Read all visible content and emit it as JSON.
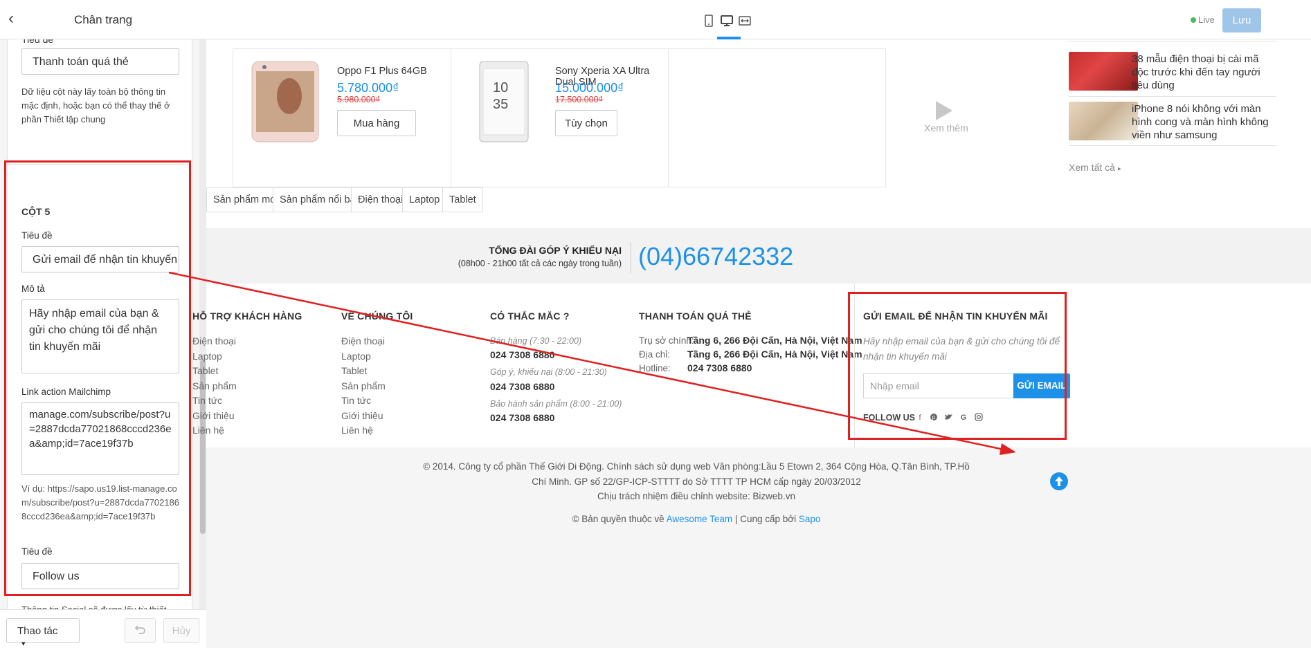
{
  "panel": {
    "title": "Chân trang",
    "back_icon": "chevron-left-icon",
    "col4": {
      "title_label": "Tiêu đề",
      "title_value": "Thanh toán quá thẻ",
      "hint": "Dữ liệu cột này lấy toàn bộ thông tin mặc định, hoặc bạn có thể thay thế ở phần Thiết lập chung"
    },
    "col5": {
      "heading": "CỘT 5",
      "title_label": "Tiêu đề",
      "title_value": "Gửi email để nhận tin khuyến mãi",
      "desc_label": "Mô tả",
      "desc_value": "Hãy nhập email của bạn & gửi cho chúng tôi để nhận tin khuyến mãi",
      "mailchimp_label": "Link action Mailchimp",
      "mailchimp_value": "manage.com/subscribe/post?u=2887dcda77021868cccd236ea&amp;id=7ace19f37b",
      "mailchimp_hint": "Ví dụ: https://sapo.us19.list-manage.com/subscribe/post?u=2887dcda77021868cccd236ea&amp;id=7ace19f37b",
      "follow_label": "Tiêu đề",
      "follow_value": "Follow us",
      "social_hint": "Thông tin Social sẽ được lấy từ thiết lập Social media"
    },
    "footer": {
      "actions_label": "Thao tác",
      "actions_caret": "▾",
      "undo_icon": "undo-icon",
      "cancel_label": "Hủy"
    }
  },
  "topbar": {
    "devices": [
      "mobile-icon",
      "desktop-icon",
      "fullwidth-icon"
    ],
    "active_device": "desktop-icon",
    "live_label": "Live",
    "save_label": "Lưu"
  },
  "preview": {
    "products": [
      {
        "name": "Oppo F1 Plus 64GB",
        "price": "5.780.000₫",
        "old_price": "5.980.000₫",
        "button": "Mua hàng"
      },
      {
        "name": "Sony Xperia XA Ultra Dual SIM",
        "price": "15.000.000₫",
        "old_price": "17.500.000₫",
        "button": "Tùy chọn"
      }
    ],
    "see_more": "Xem thêm",
    "news": [
      {
        "title": "38 mẫu điện thoại bị cài mã độc trước khi đến tay người tiêu dùng"
      },
      {
        "title": "iPhone 8 nói không với màn hình cong và màn hình không viền như samsung"
      }
    ],
    "see_all": "Xem tất cả",
    "tabs": [
      "Sản phẩm mới",
      "Sản phẩm nổi bật",
      "Điện thoại",
      "Laptop",
      "Tablet"
    ],
    "hotline": {
      "title": "TỔNG ĐÀI GÓP Ý KHIẾU NẠI",
      "hours": "(08h00 - 21h00 tất cả các ngày trong tuần)",
      "number": "(04)66742332"
    },
    "footer_cols": [
      {
        "title": "HỖ TRỢ KHÁCH HÀNG",
        "links": [
          "Điện thoại",
          "Laptop",
          "Tablet",
          "Sản phẩm",
          "Tin tức",
          "Giới thiệu",
          "Liên hệ"
        ]
      },
      {
        "title": "VỀ CHÚNG TÔI",
        "links": [
          "Điện thoại",
          "Laptop",
          "Tablet",
          "Sản phẩm",
          "Tin tức",
          "Giới thiệu",
          "Liên hệ"
        ]
      }
    ],
    "faq": {
      "title": "CÓ THẮC MẮC ?",
      "items": [
        {
          "label": "Bán hàng (7:30 - 22:00)",
          "phone": "024 7308 6880"
        },
        {
          "label": "Góp ý, khiếu nại (8:00 - 21:30)",
          "phone": "024 7308 6880"
        },
        {
          "label": "Bảo hành sản phẩm (8:00 - 21:00)",
          "phone": "024 7308 6880"
        }
      ]
    },
    "payment": {
      "title": "THANH TOÁN QUÁ THẺ",
      "rows": [
        {
          "label": "Trụ sở chính:",
          "value": "Tầng 6, 266 Đội Cấn, Hà Nội, Việt Nam"
        },
        {
          "label": "Địa chỉ:",
          "value": "Tầng 6, 266 Đội Cấn, Hà Nội, Việt Nam"
        },
        {
          "label": "Hotline:",
          "value": "024 7308 6880"
        }
      ]
    },
    "newsletter": {
      "title": "GỬI EMAIL ĐỂ NHẬN TIN KHUYẾN MÃI",
      "desc": "Hãy nhập email của bạn & gửi cho chúng tôi để nhận tin khuyến mãi",
      "placeholder": "Nhập email",
      "button": "GỬI EMAIL",
      "follow": "FOLLOW US",
      "socials": [
        "facebook-icon",
        "pinterest-icon",
        "twitter-icon",
        "google-icon",
        "instagram-icon"
      ]
    },
    "copyright": {
      "line1": "© 2014. Công ty cổ phần Thế Giới Di Động. Chính sách sử dụng web Văn phòng:Lầu 5 Etown 2, 364 Cộng Hòa, Q.Tân Bình, TP.Hồ",
      "line2": "Chí Minh. GP số 22/GP-ICP-STTTT do Sở TTTT TP HCM cấp ngày 20/03/2012",
      "line3": "Chịu trách nhiệm điều chỉnh website: Bizweb.vn",
      "line4_prefix": "© Bản quyền thuộc về",
      "line4_link1": "Awesome Team",
      "line4_mid": "| Cung cấp bởi",
      "line4_link2": "Sapo"
    }
  },
  "colors": {
    "accent": "#1d91e8",
    "annotation_red": "#e02020",
    "old_price": "#e23b3b"
  }
}
